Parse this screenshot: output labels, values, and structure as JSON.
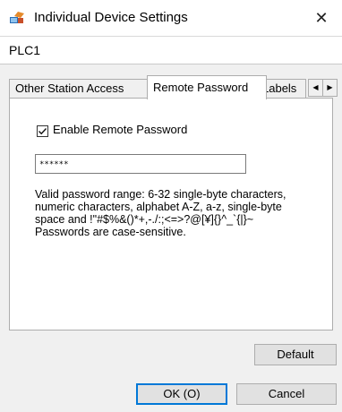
{
  "window": {
    "title": "Individual Device Settings",
    "close_glyph": "✕"
  },
  "device": {
    "name": "PLC1"
  },
  "tabs": [
    {
      "label": "Other Station Access",
      "active": false
    },
    {
      "label": "Remote Password",
      "active": true
    },
    {
      "label": "Labels",
      "active": false
    }
  ],
  "tab_scroll": {
    "left": "◀",
    "right": "▶"
  },
  "remote_password": {
    "enable_label": "Enable Remote Password",
    "enabled": true,
    "password_value": "******",
    "info_lines": [
      "Valid password range: 6-32 single-byte characters,",
      "numeric characters, alphabet A-Z, a-z, single-byte",
      "space and !\"#$%&()*+,-./:;<=>?@[¥]{}^_`{|}~",
      "Passwords are case-sensitive."
    ]
  },
  "buttons": {
    "default": "Default",
    "ok": "OK (O)",
    "cancel": "Cancel"
  },
  "colors": {
    "accent": "#0078d7",
    "title_bg": "#ffffff",
    "dialog_bg": "#f0f0f0"
  }
}
